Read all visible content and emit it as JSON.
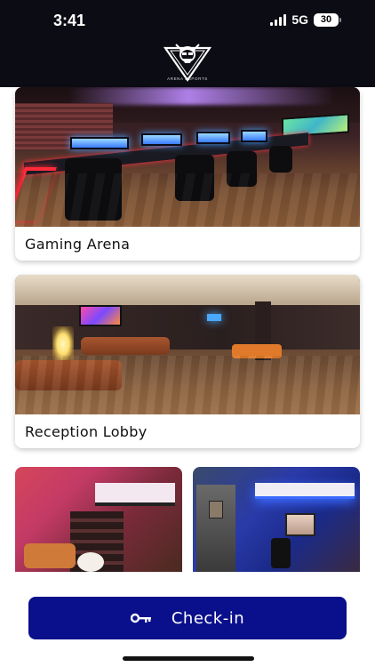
{
  "status_bar": {
    "time": "3:41",
    "network": "5G",
    "battery": "30"
  },
  "header": {
    "logo_text": "ARENA ESPORTS"
  },
  "cards": [
    {
      "caption": "Gaming Arena"
    },
    {
      "caption": "Reception Lobby"
    }
  ],
  "room_tiles": [
    {
      "id": "room-1"
    },
    {
      "id": "room-2"
    }
  ],
  "checkin": {
    "label": "Check-in",
    "icon": "key-icon",
    "color": "#0a0f8c"
  }
}
